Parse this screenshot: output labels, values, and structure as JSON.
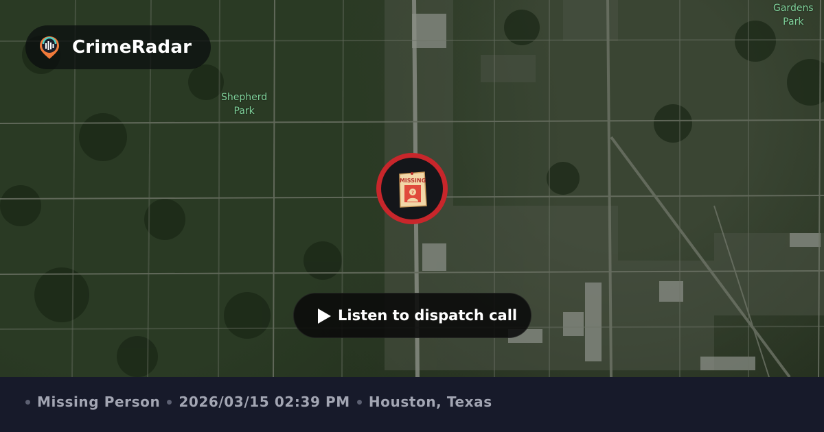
{
  "app": {
    "brand_name": "CrimeRadar"
  },
  "map": {
    "place_labels": [
      {
        "line1": "Shepherd",
        "line2": "Park"
      },
      {
        "line1": "Gardens",
        "line2": "Park"
      }
    ],
    "marker": {
      "icon": "missing-poster-icon",
      "poster_text": "MISSING",
      "ring_color": "#c8262b"
    }
  },
  "dispatch": {
    "button_label": "Listen to dispatch call",
    "icon": "play-icon"
  },
  "incident": {
    "type": "Missing Person",
    "datetime": "2026/03/15 02:39 PM",
    "location": "Houston, Texas"
  },
  "colors": {
    "footer_bg": "#171a2a",
    "accent_red": "#c8262b",
    "label_green": "#7fd19a"
  }
}
